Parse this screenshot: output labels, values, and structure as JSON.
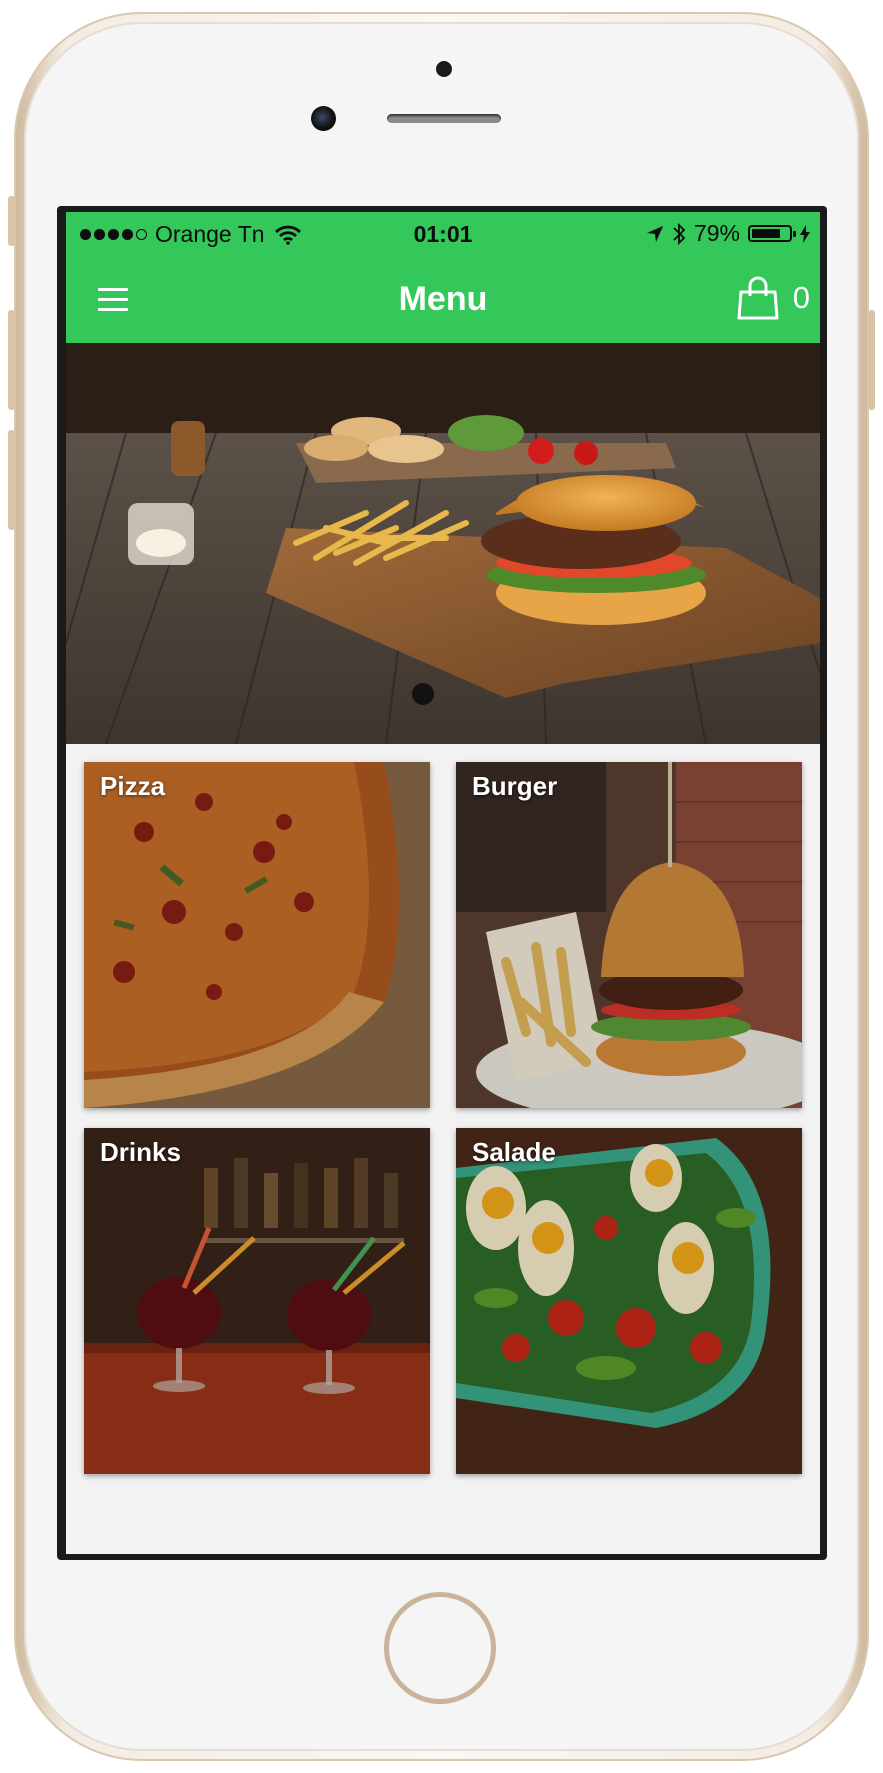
{
  "status_bar": {
    "carrier": "Orange Tn",
    "time": "01:01",
    "battery": "79%",
    "battery_level": 0.79,
    "icons": [
      "signal-dots-icon",
      "wifi-icon",
      "location-arrow-icon",
      "bluetooth-icon",
      "battery-icon",
      "charging-bolt-icon"
    ]
  },
  "nav": {
    "title": "Menu",
    "cart_count": "0",
    "icons": [
      "hamburger-menu-icon",
      "shopping-bag-icon"
    ]
  },
  "hero": {
    "image": "burger-and-fries-on-wooden-board",
    "page_indicator_count": 1,
    "page_indicator_active": 1
  },
  "categories": [
    {
      "label": "Pizza",
      "image": "pizza-photo"
    },
    {
      "label": "Burger",
      "image": "burger-with-fries-photo"
    },
    {
      "label": "Drinks",
      "image": "red-drinks-photo"
    },
    {
      "label": "Salade",
      "image": "salad-with-eggs-photo"
    }
  ],
  "colors": {
    "accent": "#34c759",
    "text_on_accent": "#ffffff",
    "background": "#f2f2f2"
  }
}
